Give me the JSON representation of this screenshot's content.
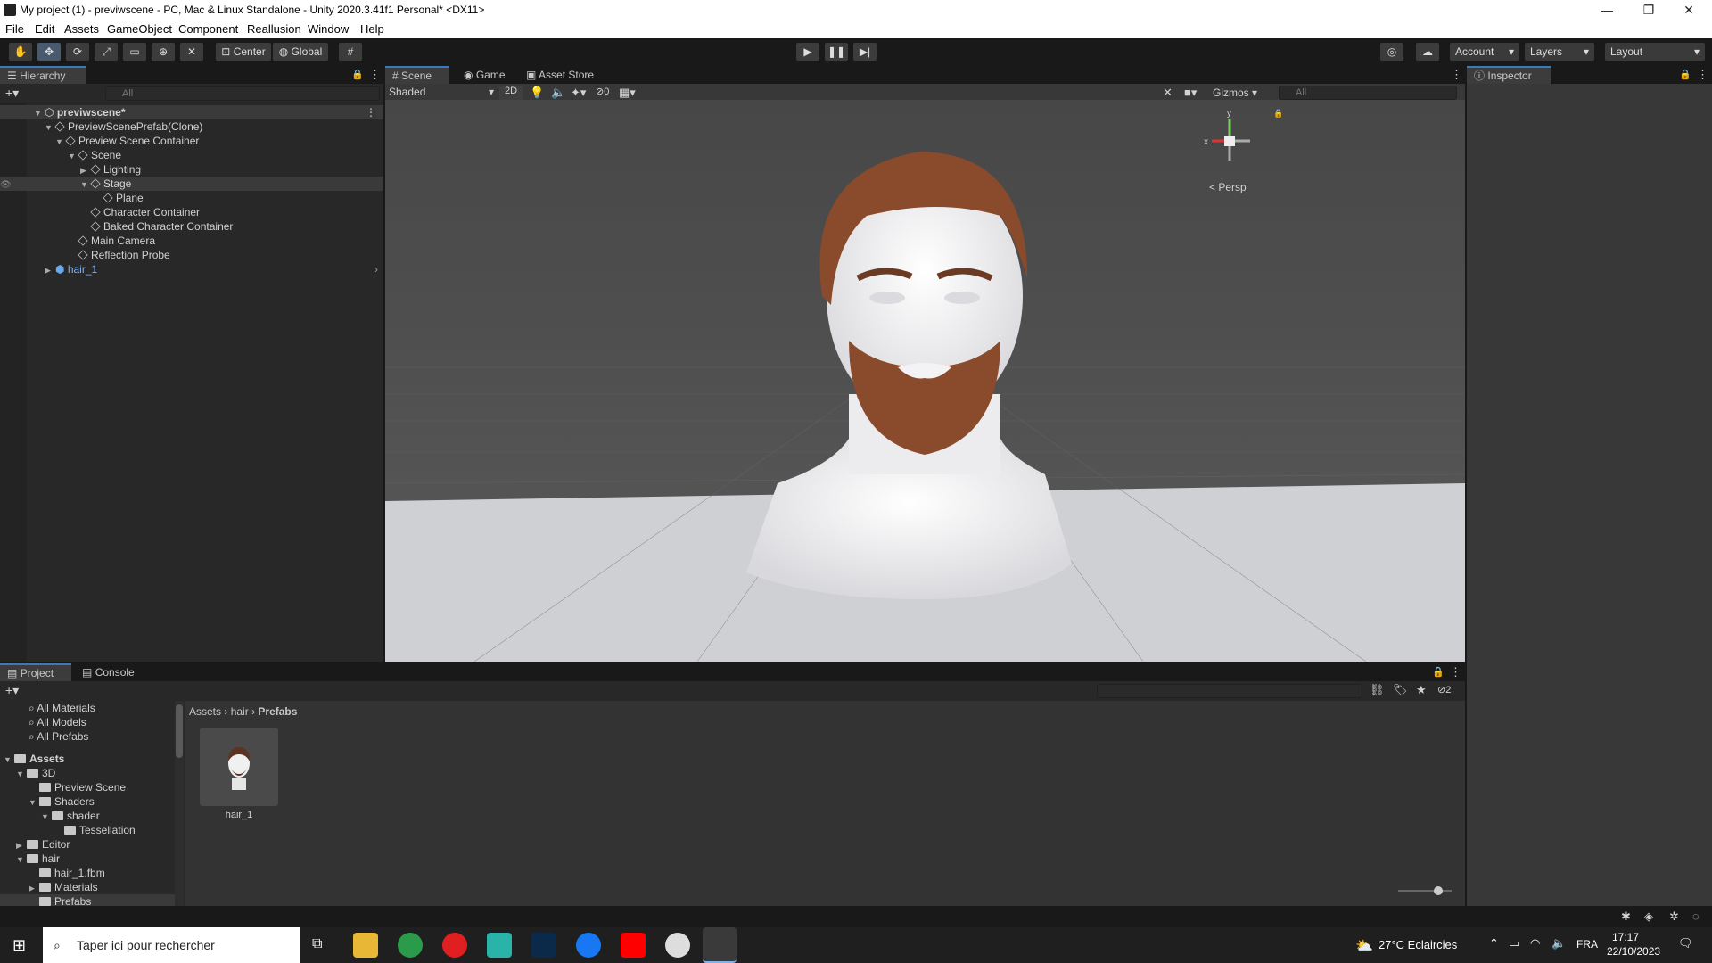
{
  "window": {
    "title": "My project (1) - previwscene - PC, Mac & Linux Standalone - Unity 2020.3.41f1 Personal* <DX11>",
    "minimize": "—",
    "maximize": "❐",
    "close": "✕"
  },
  "menu": [
    "File",
    "Edit",
    "Assets",
    "GameObject",
    "Component",
    "Reallusion",
    "Window",
    "Help"
  ],
  "toolbar": {
    "pivot": "Center",
    "space": "Global",
    "account": "Account",
    "layers": "Layers",
    "layout": "Layout"
  },
  "hierarchy": {
    "tab": "Hierarchy",
    "search_placeholder": "All",
    "items": [
      {
        "label": "previwscene*",
        "depth": 0,
        "bold": true
      },
      {
        "label": "PreviewScenePrefab(Clone)",
        "depth": 1
      },
      {
        "label": "Preview Scene Container",
        "depth": 2
      },
      {
        "label": "Scene",
        "depth": 3
      },
      {
        "label": "Lighting",
        "depth": 4
      },
      {
        "label": "Stage",
        "depth": 4
      },
      {
        "label": "Plane",
        "depth": 5
      },
      {
        "label": "Character Container",
        "depth": 4
      },
      {
        "label": "Baked Character Container",
        "depth": 4
      },
      {
        "label": "Main Camera",
        "depth": 3
      },
      {
        "label": "Reflection Probe",
        "depth": 3
      },
      {
        "label": "hair_1",
        "depth": 1,
        "prefab": true
      }
    ]
  },
  "scene": {
    "tabs": [
      "Scene",
      "Game",
      "Asset Store"
    ],
    "shading": "Shaded",
    "mode2d": "2D",
    "hidden_count": "0",
    "gizmos": "Gizmos",
    "search_placeholder": "All",
    "persp": "< Persp",
    "axis_y": "y",
    "axis_x": "x"
  },
  "inspector": {
    "tab": "Inspector"
  },
  "project": {
    "tabs": [
      "Project",
      "Console"
    ],
    "favorites": [
      "All Materials",
      "All Models",
      "All Prefabs"
    ],
    "tree": [
      {
        "label": "Assets",
        "depth": 0,
        "bold": true
      },
      {
        "label": "3D",
        "depth": 1
      },
      {
        "label": "Preview Scene",
        "depth": 2
      },
      {
        "label": "Shaders",
        "depth": 2
      },
      {
        "label": "shader",
        "depth": 3
      },
      {
        "label": "Tessellation",
        "depth": 4
      },
      {
        "label": "Editor",
        "depth": 1
      },
      {
        "label": "hair",
        "depth": 1
      },
      {
        "label": "hair_1.fbm",
        "depth": 2
      },
      {
        "label": "Materials",
        "depth": 2
      },
      {
        "label": "Prefabs",
        "depth": 2,
        "selected": true
      }
    ],
    "breadcrumb": [
      "Assets",
      "hair",
      "Prefabs"
    ],
    "asset_name": "hair_1",
    "hidden_count": "2"
  },
  "taskbar": {
    "search_placeholder": "Taper ici pour rechercher",
    "weather": "27°C  Eclaircies",
    "language": "FRA",
    "time": "17:17",
    "date": "22/10/2023"
  },
  "colors": {
    "accent": "#3a79bb",
    "panel": "#282828",
    "toolbar": "#191919",
    "skin": "#f0f0f2",
    "hair": "#8a4a2c"
  }
}
